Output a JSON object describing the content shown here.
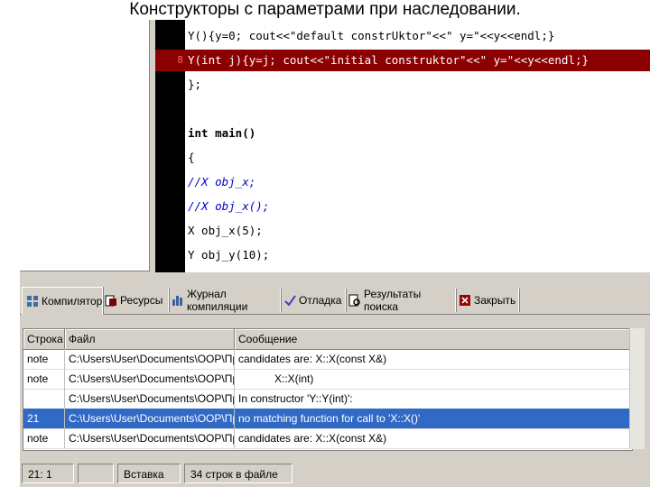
{
  "slide_title": "Конструкторы с параметрами при наследовании.",
  "editor": {
    "lines": [
      {
        "ln": "",
        "text": "Y(){y=0; cout<<\"default constrUktor\"<<\" y=\"<<y<<endl;}",
        "highlight": false
      },
      {
        "ln": "8",
        "text": "Y(int j){y=j; cout<<\"initial construktor\"<<\" y=\"<<y<<endl;}",
        "highlight": true
      },
      {
        "ln": "",
        "text": "};",
        "highlight": false
      },
      {
        "ln": "",
        "text": "",
        "highlight": false
      },
      {
        "ln": "",
        "text": "int main()",
        "highlight": false
      },
      {
        "ln": "",
        "text": "{",
        "highlight": false
      },
      {
        "ln": "",
        "text": "//X obj_x;",
        "highlight": false
      },
      {
        "ln": "",
        "text": "//X obj_x();",
        "highlight": false
      },
      {
        "ln": "",
        "text": "X obj_x(5);",
        "highlight": false
      },
      {
        "ln": "",
        "text": "Y obj_y(10);",
        "highlight": false
      }
    ]
  },
  "tabs": [
    {
      "label": "Компилятор",
      "icon": "grid-icon",
      "active": true
    },
    {
      "label": "Ресурсы",
      "icon": "resources-icon",
      "active": false
    },
    {
      "label": "Журнал компиляции",
      "icon": "chart-icon",
      "active": false
    },
    {
      "label": "Отладка",
      "icon": "checkmark-icon",
      "active": false
    },
    {
      "label": "Результаты поиска",
      "icon": "search-results-icon",
      "active": false
    },
    {
      "label": "Закрыть",
      "icon": "close-tab-icon",
      "active": false
    }
  ],
  "messages": {
    "headers": {
      "line": "Строка",
      "file": "Файл",
      "message": "Сообщение"
    },
    "rows": [
      {
        "line": "note",
        "file": "C:\\Users\\User\\Documents\\OOP\\Пр...",
        "message": "candidates are: X::X(const X&)",
        "selected": false
      },
      {
        "line": "note",
        "file": "C:\\Users\\User\\Documents\\OOP\\Пр...",
        "message": "            X::X(int)",
        "selected": false
      },
      {
        "line": "",
        "file": "C:\\Users\\User\\Documents\\OOP\\Пр...",
        "message": "In constructor 'Y::Y(int)':",
        "selected": false
      },
      {
        "line": "21",
        "file": "C:\\Users\\User\\Documents\\OOP\\Пр...",
        "message": "no matching function for call to 'X::X()'",
        "selected": true
      },
      {
        "line": "note",
        "file": "C:\\Users\\User\\Documents\\OOP\\Пр...",
        "message": "candidates are: X::X(const X&)",
        "selected": false
      }
    ]
  },
  "status": {
    "position": "21: 1",
    "mode": "Вставка",
    "lines_info": "34 строк в файле"
  },
  "colors": {
    "highlight_line": "#8b0000",
    "selected_row": "#316ac5",
    "gutter": "#000000",
    "chrome": "#d4d0c8"
  }
}
